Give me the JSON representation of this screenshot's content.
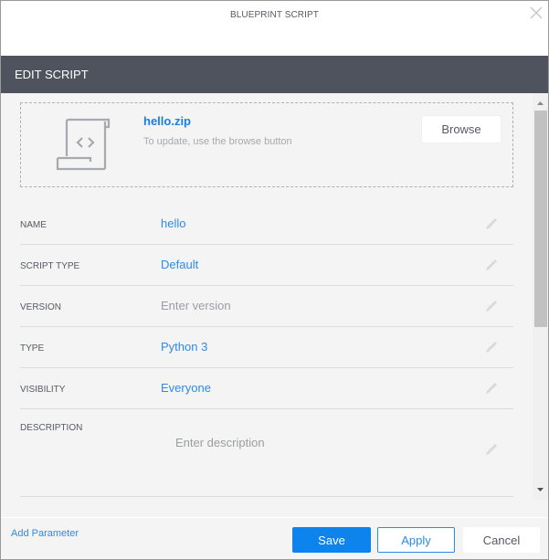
{
  "window": {
    "title": "BLUEPRINT SCRIPT",
    "close_icon": "close-icon"
  },
  "section": {
    "title": "EDIT SCRIPT"
  },
  "upload": {
    "icon": "script-file-icon",
    "file_name": "hello.zip",
    "hint": "To update, use the browse button",
    "browse_label": "Browse"
  },
  "fields": [
    {
      "label": "NAME",
      "value": "hello",
      "is_placeholder": false,
      "icon": "pencil-icon"
    },
    {
      "label": "SCRIPT TYPE",
      "value": "Default",
      "is_placeholder": false,
      "icon": "pencil-icon"
    },
    {
      "label": "VERSION",
      "value": "Enter version",
      "is_placeholder": true,
      "icon": "pencil-icon"
    },
    {
      "label": "TYPE",
      "value": "Python 3",
      "is_placeholder": false,
      "icon": "pencil-icon"
    },
    {
      "label": "VISIBILITY",
      "value": "Everyone",
      "is_placeholder": false,
      "icon": "pencil-icon"
    },
    {
      "label": "DESCRIPTION",
      "value": "Enter description",
      "is_placeholder": true,
      "icon": "pencil-icon"
    }
  ],
  "footer": {
    "add_parameter_label": "Add Parameter",
    "save_label": "Save",
    "apply_label": "Apply",
    "cancel_label": "Cancel"
  },
  "colors": {
    "accent": "#0d84ed",
    "link": "#2c8be8",
    "header_bg": "#4f535d",
    "body_bg": "#f4f4f4"
  }
}
